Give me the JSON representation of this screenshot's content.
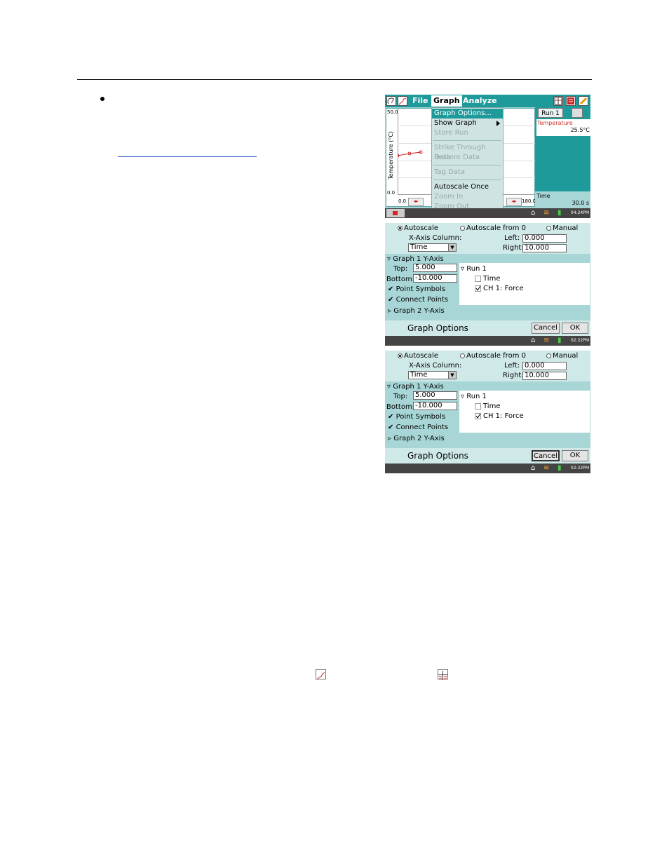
{
  "screen1": {
    "menus": [
      "File",
      "Graph",
      "Analyze"
    ],
    "graph_menu": {
      "items": [
        {
          "label": "Graph Options...",
          "enabled": true,
          "selected": true
        },
        {
          "label": "Show Graph",
          "enabled": true,
          "submenu": true
        },
        {
          "label": "Store Run",
          "enabled": false
        },
        {
          "label": "Strike Through Data",
          "enabled": false
        },
        {
          "label": "Restore Data",
          "enabled": false
        },
        {
          "label": "Tag Data",
          "enabled": false
        },
        {
          "label": "Autoscale Once",
          "enabled": true
        },
        {
          "label": "Zoom In",
          "enabled": false
        },
        {
          "label": "Zoom Out",
          "enabled": false
        }
      ]
    },
    "graph": {
      "ylabel": "Temperature (°C)",
      "y_top": "50.0",
      "y_bottom": "0.0",
      "x_left": "0.0",
      "x_right": "180.0"
    },
    "run_button": "Run 1",
    "meter_label": "Temperature",
    "meter_value": "25.5°C",
    "time_label": "Time",
    "time_value": "30.0 s",
    "clock": "04:24PM",
    "colors": {
      "accent": "#1f9a9a",
      "background": "#a8d6d6",
      "series": "#cc2222"
    }
  },
  "dialog": {
    "mode_autoscale": "Autoscale",
    "mode_autoscale_zero": "Autoscale from 0",
    "mode_manual": "Manual",
    "xaxis_column_label": "X-Axis Column:",
    "xaxis_column_value": "Time",
    "left_label": "Left:",
    "left_value": "0.000",
    "right_label": "Right:",
    "right_value": "10.000",
    "graph1_header": "Graph 1 Y-Axis",
    "top_label": "Top:",
    "top_value": "5.000",
    "bottom_label": "Bottom:",
    "bottom_value": "-10.000",
    "point_symbols": "Point Symbols",
    "connect_points": "Connect Points",
    "graph2_header": "Graph 2 Y-Axis",
    "run_label": "Run 1",
    "col_time": "Time",
    "col_force": "CH 1: Force",
    "title": "Graph Options",
    "cancel": "Cancel",
    "ok": "OK",
    "clock": "02:22PM"
  }
}
